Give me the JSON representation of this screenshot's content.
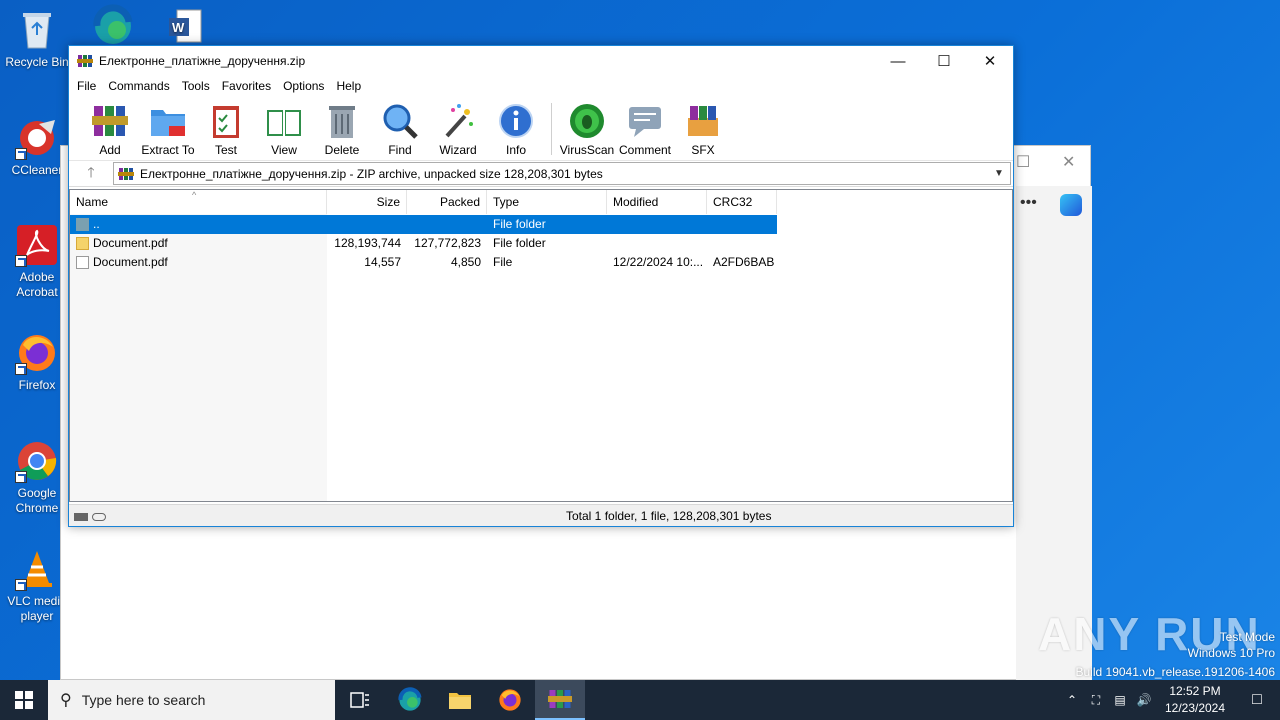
{
  "desktop": {
    "icons": [
      {
        "label": "Recycle Bin"
      },
      {
        "label": "CCleaner"
      },
      {
        "label": "Adobe Acrobat"
      },
      {
        "label": "Firefox"
      },
      {
        "label": "Google Chrome"
      },
      {
        "label": "VLC media player"
      }
    ]
  },
  "window": {
    "title": "Електронне_платіжне_доручення.zip",
    "menu": [
      "File",
      "Commands",
      "Tools",
      "Favorites",
      "Options",
      "Help"
    ],
    "toolbar": [
      "Add",
      "Extract To",
      "Test",
      "View",
      "Delete",
      "Find",
      "Wizard",
      "Info",
      "VirusScan",
      "Comment",
      "SFX"
    ],
    "address": "Електронне_платіжне_доручення.zip - ZIP archive, unpacked size 128,208,301 bytes",
    "columns": {
      "name": "Name",
      "size": "Size",
      "packed": "Packed",
      "type": "Type",
      "modified": "Modified",
      "crc": "CRC32"
    },
    "rows": [
      {
        "name": "..",
        "size": "",
        "packed": "",
        "type": "File folder",
        "modified": "",
        "crc": ""
      },
      {
        "name": "Document.pdf",
        "size": "128,193,744",
        "packed": "127,772,823",
        "type": "File folder",
        "modified": "",
        "crc": ""
      },
      {
        "name": "Document.pdf",
        "size": "14,557",
        "packed": "4,850",
        "type": "File",
        "modified": "12/22/2024 10:...",
        "crc": "A2FD6BAB"
      }
    ],
    "status": "Total 1 folder, 1 file, 128,208,301 bytes"
  },
  "watermark": {
    "brand": "ANY RUN",
    "line1": "Test Mode",
    "line2": "Windows 10 Pro",
    "line3": "Build 19041.vb_release.191206-1406"
  },
  "taskbar": {
    "search_placeholder": "Type here to search",
    "time": "12:52 PM",
    "date": "12/23/2024"
  }
}
